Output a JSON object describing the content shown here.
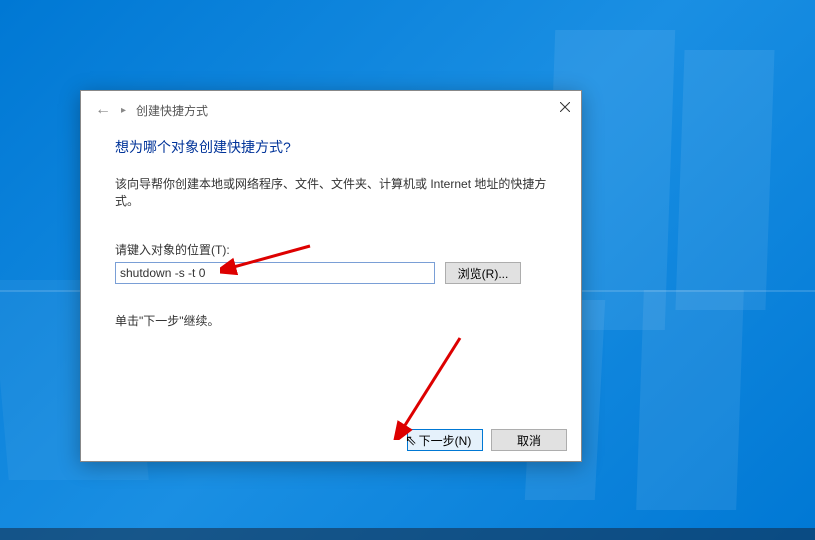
{
  "titlebar": {
    "breadcrumb": "创建快捷方式"
  },
  "content": {
    "heading": "想为哪个对象创建快捷方式?",
    "description": "该向导帮你创建本地或网络程序、文件、文件夹、计算机或 Internet 地址的快捷方式。",
    "location_label": "请键入对象的位置(T):",
    "location_value": "shutdown -s -t 0",
    "browse_label": "浏览(R)...",
    "hint": "单击\"下一步\"继续。"
  },
  "buttons": {
    "next": "下一步(N)",
    "cancel": "取消"
  }
}
